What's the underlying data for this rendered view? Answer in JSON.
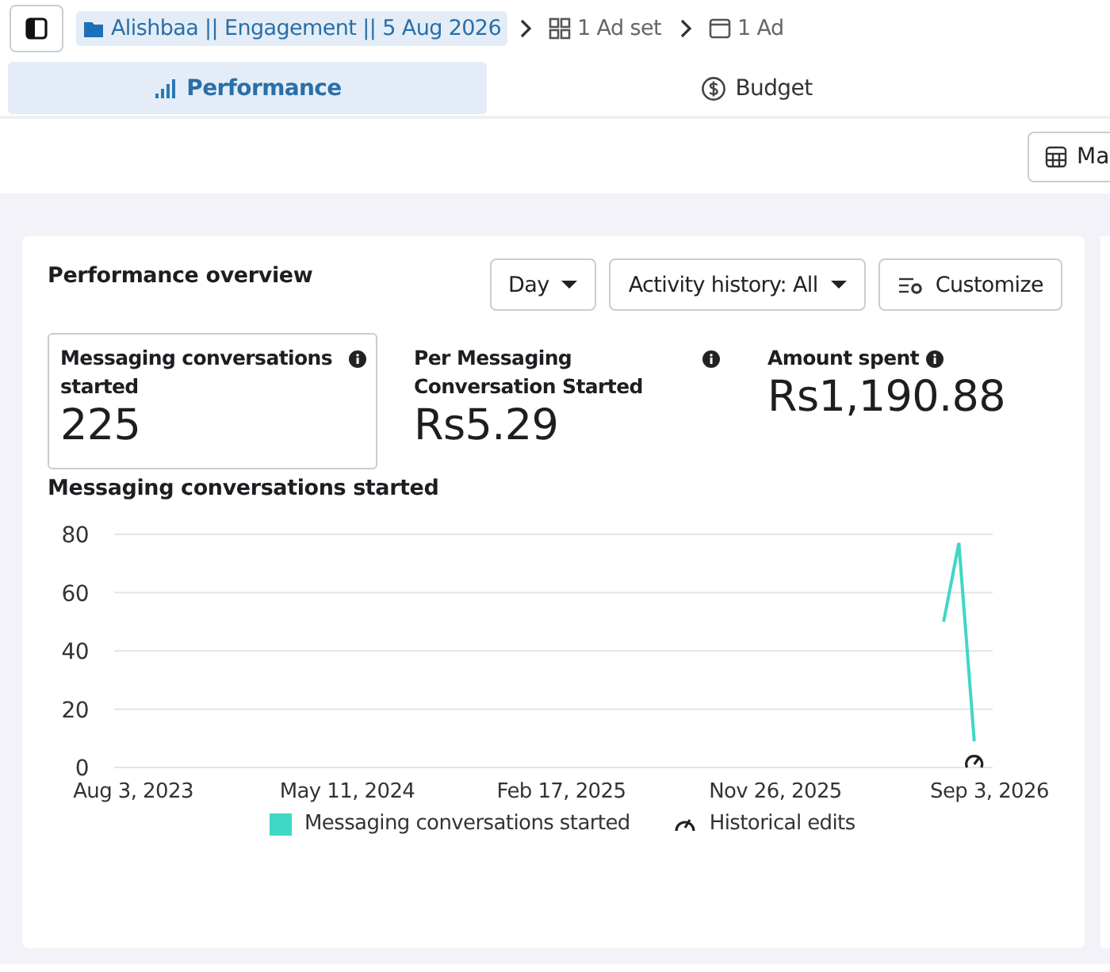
{
  "breadcrumb": [
    {
      "kind": "campaign",
      "label": "Alishbaa || Engagement || 5 Aug 2026",
      "selected": true
    },
    {
      "kind": "adset",
      "label": "1 Ad set",
      "selected": false
    },
    {
      "kind": "ad",
      "label": "1 Ad",
      "selected": false
    }
  ],
  "tabs": [
    {
      "kind": "chart",
      "label": "Performance",
      "selected": true
    },
    {
      "kind": "money",
      "label": "Budget",
      "selected": false
    }
  ],
  "toolbar": {
    "button": "Ma"
  },
  "card": {
    "title": "Performance overview",
    "controls": [
      {
        "kind": "dropdown",
        "label": "Day"
      },
      {
        "kind": "dropdown",
        "label": "Activity history: All"
      },
      {
        "kind": "customize",
        "label": "Customize"
      }
    ],
    "metrics": [
      {
        "label": "Messaging conversations started",
        "value": "225",
        "selected": true
      },
      {
        "label": "Per Messaging Conversation Started",
        "value": "Rs5.29",
        "selected": false
      },
      {
        "label": "Amount spent",
        "value": "Rs1,190.88",
        "selected": false
      }
    ],
    "chart_title": "Messaging conversations started",
    "chart_data": {
      "type": "line",
      "categories": [
        "Aug 3, 2023",
        null,
        null,
        null,
        null,
        null,
        null,
        null,
        null,
        null,
        null,
        null,
        null,
        null,
        "May 11, 2024",
        null,
        null,
        null,
        null,
        null,
        null,
        null,
        null,
        null,
        null,
        null,
        null,
        null,
        "Feb 17, 2025",
        null,
        null,
        null,
        null,
        null,
        null,
        null,
        null,
        null,
        null,
        null,
        null,
        null,
        "Nov 26, 2025",
        null,
        null,
        null,
        null,
        null,
        null,
        null,
        null,
        null,
        null,
        null,
        null,
        null,
        "Sep 3, 2026"
      ],
      "series": [
        {
          "name": "Messaging conversations started",
          "color": "#3fd7c5",
          "values": [
            null,
            null,
            null,
            null,
            null,
            null,
            null,
            null,
            null,
            null,
            null,
            null,
            null,
            null,
            null,
            null,
            null,
            null,
            null,
            null,
            null,
            null,
            null,
            null,
            null,
            null,
            null,
            null,
            null,
            null,
            null,
            null,
            null,
            null,
            null,
            null,
            null,
            null,
            null,
            null,
            null,
            null,
            null,
            null,
            null,
            null,
            null,
            null,
            null,
            null,
            null,
            null,
            null,
            50,
            77,
            9,
            null
          ]
        }
      ],
      "ylim": [
        0,
        80
      ],
      "yticks": [
        0,
        20,
        40,
        60,
        80
      ],
      "grid": true
    },
    "legend_extra": "Historical edits"
  }
}
